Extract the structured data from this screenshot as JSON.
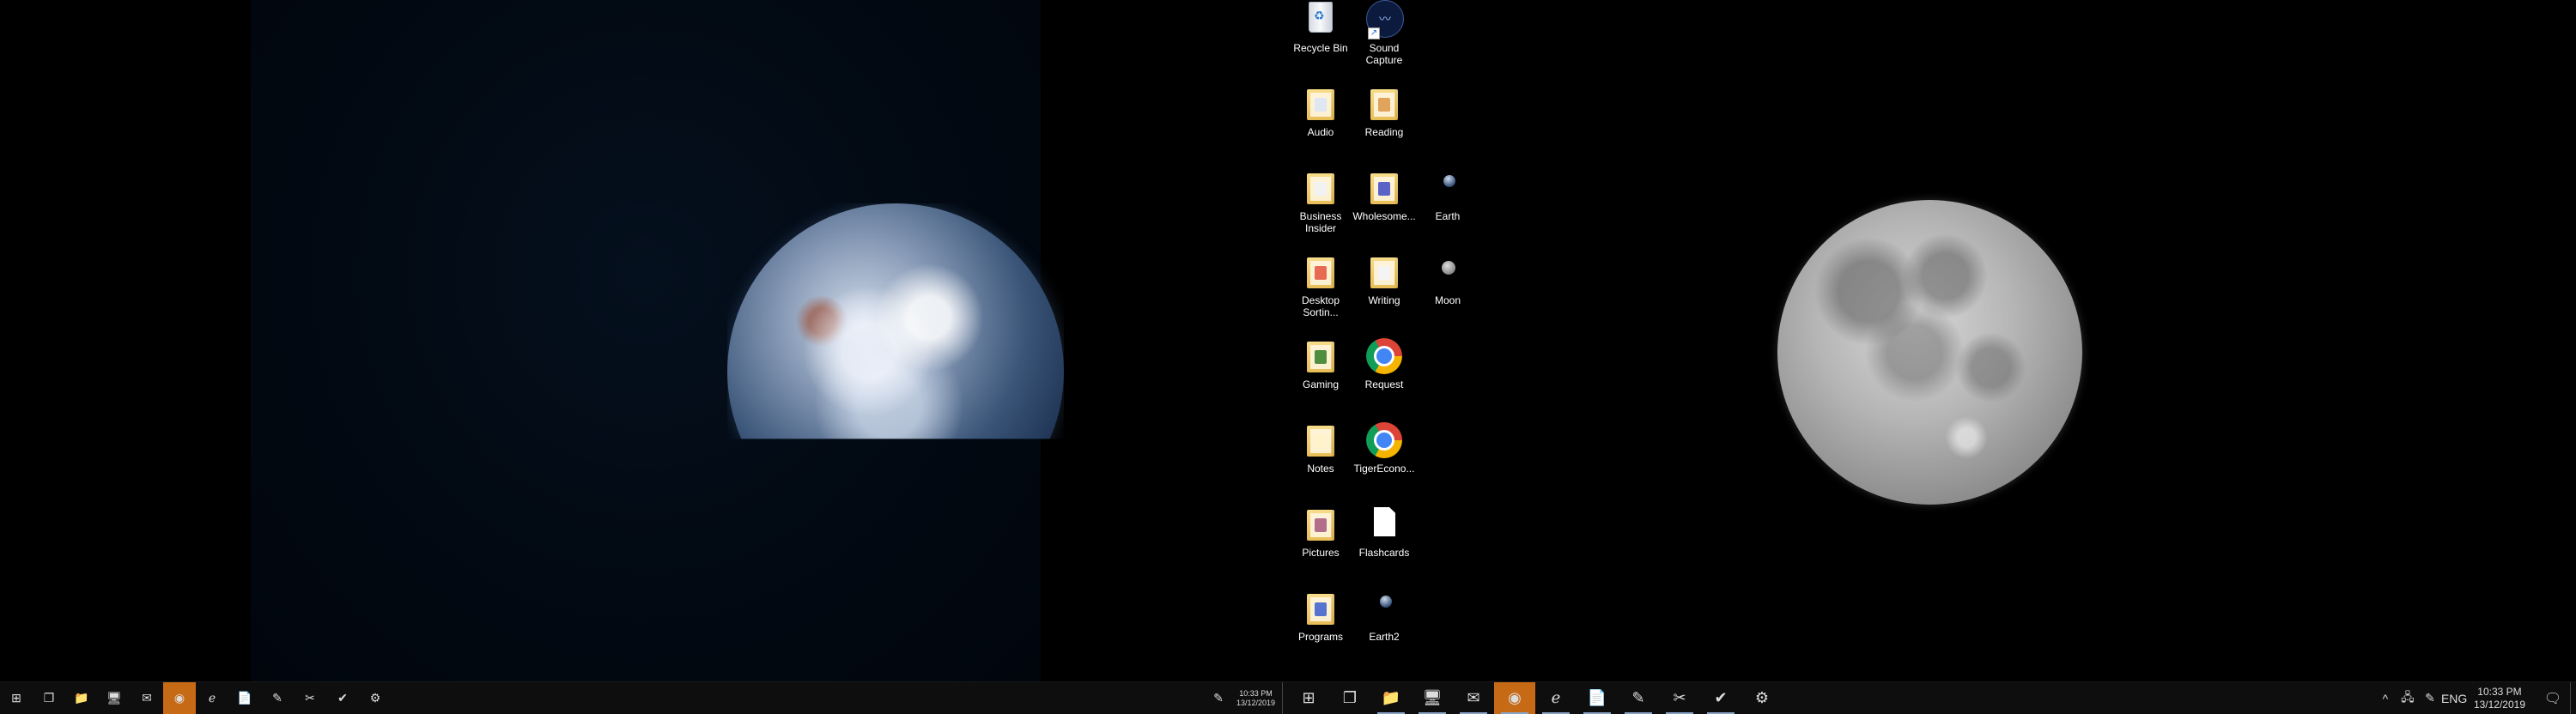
{
  "desktop": {
    "icons": [
      {
        "label": "Recycle Bin",
        "icon": "recycle-bin-icon"
      },
      {
        "label": "Sound Capture",
        "icon": "sound-capture-icon"
      },
      {
        "label": "Audio",
        "icon": "folder-icon"
      },
      {
        "label": "Reading",
        "icon": "folder-icon"
      },
      {
        "label": "Business Insider",
        "icon": "folder-icon"
      },
      {
        "label": "Wholesome...",
        "icon": "folder-icon"
      },
      {
        "label": "Earth",
        "icon": "image-icon"
      },
      {
        "label": "Desktop Sortin...",
        "icon": "folder-icon"
      },
      {
        "label": "Writing",
        "icon": "folder-icon"
      },
      {
        "label": "Moon",
        "icon": "image-icon"
      },
      {
        "label": "Gaming",
        "icon": "folder-icon"
      },
      {
        "label": "Request",
        "icon": "chrome-icon"
      },
      {
        "label": "Notes",
        "icon": "folder-icon"
      },
      {
        "label": "TigerEcono...",
        "icon": "chrome-icon"
      },
      {
        "label": "Pictures",
        "icon": "folder-icon"
      },
      {
        "label": "Flashcards",
        "icon": "document-icon"
      },
      {
        "label": "Programs",
        "icon": "folder-icon"
      },
      {
        "label": "Earth2",
        "icon": "image-icon"
      }
    ]
  },
  "taskbar_left": {
    "buttons": [
      "windows-start-icon",
      "task-view-icon",
      "file-explorer-icon",
      "monitor-icon",
      "mail-icon",
      "chrome-icon",
      "edge-icon",
      "document-icon",
      "pen-tablet-icon",
      "snip-icon",
      "checkmark-icon",
      "settings-icon"
    ],
    "clock_time": "10:33 PM",
    "clock_date": "13/12/2019"
  },
  "taskbar_right": {
    "buttons": [
      "windows-start-icon",
      "task-view-icon",
      "file-explorer-icon",
      "monitor-icon",
      "mail-icon",
      "chrome-icon",
      "edge-icon",
      "document-icon",
      "pen-tablet-icon",
      "snip-icon",
      "checkmark-icon",
      "settings-icon"
    ],
    "language": "ENG",
    "clock_time": "10:33 PM",
    "clock_date": "13/12/2019"
  },
  "colors": {
    "taskbar": "#0e0e0e",
    "active_app": "#c76a16",
    "desktop_bg": "#000000"
  }
}
